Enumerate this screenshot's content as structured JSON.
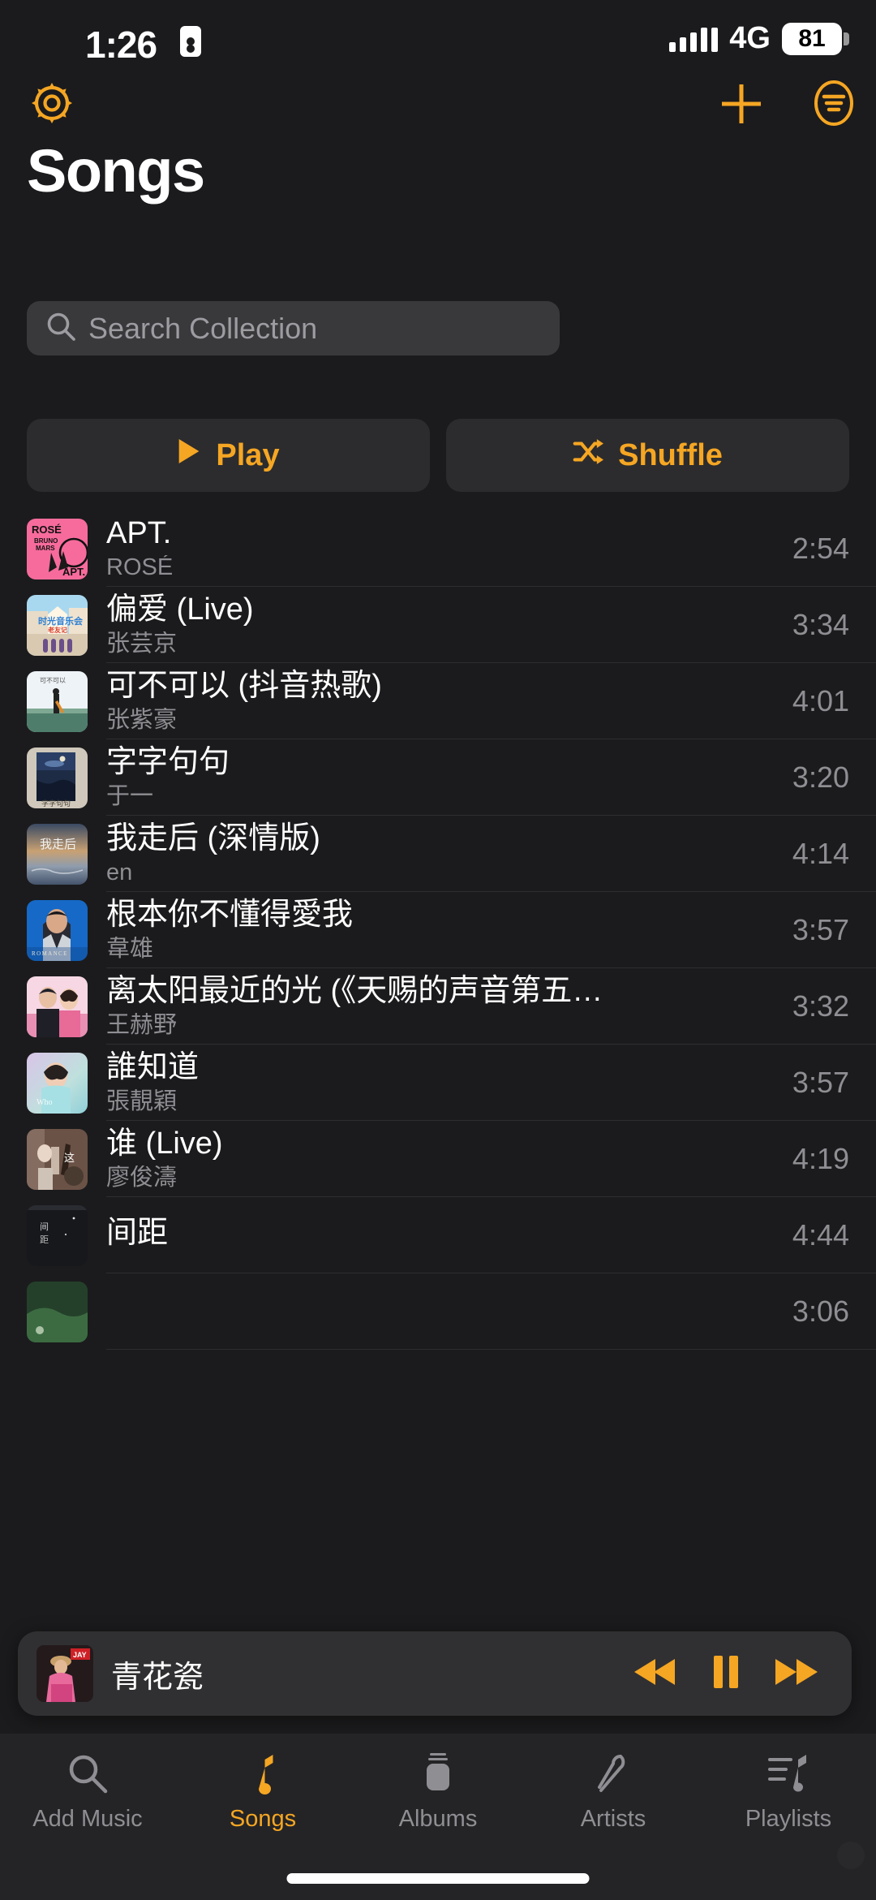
{
  "status_bar": {
    "time": "1:26",
    "network": "4G",
    "battery_percent": "81",
    "signal_bars": 5,
    "recording_icon": "recording-indicator-icon"
  },
  "toolbar": {
    "settings_icon": "gear-icon",
    "add_icon": "plus-icon",
    "sort_icon": "sort-list-circle-icon"
  },
  "header": {
    "title": "Songs"
  },
  "search": {
    "placeholder": "Search Collection",
    "value": "",
    "icon": "search-icon"
  },
  "actions": {
    "play_label": "Play",
    "play_icon": "play-triangle-icon",
    "shuffle_label": "Shuffle",
    "shuffle_icon": "shuffle-icon"
  },
  "colors": {
    "accent": "#f5a623",
    "background": "#1b1b1d",
    "surface": "#2c2c2e",
    "search_field": "#39393c",
    "tabbar": "#242426",
    "primary_text": "#ffffff",
    "secondary_text": "#8e8e93",
    "separator": "#2e2e30"
  },
  "songs": [
    {
      "title": "APT.",
      "artist": "ROSÉ",
      "duration": "2:54",
      "art": "apt-rose-bruno-mars-pink"
    },
    {
      "title": "偏爱 (Live)",
      "artist": "张芸京",
      "duration": "3:34",
      "art": "shiguang-concert-street"
    },
    {
      "title": "可不可以 (抖音热歌)",
      "artist": "张紫豪",
      "duration": "4:01",
      "art": "kebukeyi-man-on-road"
    },
    {
      "title": "字字句句",
      "artist": "于一",
      "duration": "3:20",
      "art": "zizijuju-night-sky"
    },
    {
      "title": "我走后 (深情版)",
      "artist": "en",
      "duration": "4:14",
      "art": "wozouhou-clouds-sunset"
    },
    {
      "title": "根本你不懂得愛我",
      "artist": "韋雄",
      "duration": "3:57",
      "art": "romance-blue-portrait"
    },
    {
      "title": "离太阳最近的光 (《天赐的声音第五季》…",
      "artist": "王赫野",
      "duration": "3:32",
      "art": "litaiyang-duo-pink"
    },
    {
      "title": "誰知道",
      "artist": "張靚穎",
      "duration": "3:57",
      "art": "shuizhidao-who-knows"
    },
    {
      "title": "谁 (Live)",
      "artist": "廖俊濤",
      "duration": "4:19",
      "art": "shui-live-band-room"
    },
    {
      "title": "间距",
      "artist": "",
      "duration": "4:44",
      "art": "jianju-dark-cover"
    },
    {
      "title": "",
      "artist": "",
      "duration": "3:06",
      "art": "partial-green-cover"
    }
  ],
  "mini_player": {
    "title": "青花瓷",
    "art": "jay-chou-album",
    "rewind_icon": "rewind-icon",
    "pause_icon": "pause-icon",
    "forward_icon": "fast-forward-icon",
    "is_playing": true
  },
  "tabs": [
    {
      "label": "Add Music",
      "icon": "search-icon",
      "active": false
    },
    {
      "label": "Songs",
      "icon": "music-note-icon",
      "active": true
    },
    {
      "label": "Albums",
      "icon": "album-stack-icon",
      "active": false
    },
    {
      "label": "Artists",
      "icon": "microphone-icon",
      "active": false
    },
    {
      "label": "Playlists",
      "icon": "playlist-note-icon",
      "active": false
    }
  ]
}
